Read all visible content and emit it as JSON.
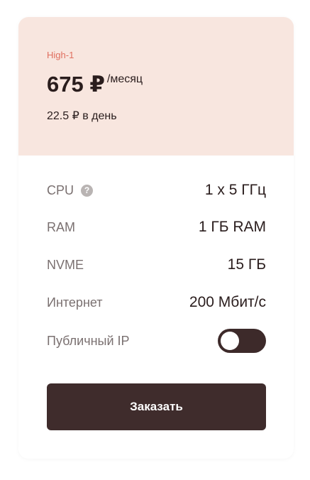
{
  "plan": {
    "name": "High-1",
    "price": "675 ₽",
    "period": "/месяц",
    "per_day": "22.5 ₽ в день"
  },
  "specs": [
    {
      "label": "CPU",
      "value": "1 x 5 ГГц",
      "help_icon": "?"
    },
    {
      "label": "RAM",
      "value": "1 ГБ RAM"
    },
    {
      "label": "NVME",
      "value": "15 ГБ"
    },
    {
      "label": "Интернет",
      "value": "200 Мбит/с"
    }
  ],
  "public_ip": {
    "label": "Публичный IP",
    "enabled": false
  },
  "order_button": {
    "label": "Заказать"
  },
  "colors": {
    "header_bg": "#f8e6df",
    "accent": "#e06f5f",
    "dark": "#3f2c2c",
    "muted_text": "#7a7070"
  },
  "icons": {
    "help": "question-circle-icon",
    "toggle": "toggle-switch"
  }
}
